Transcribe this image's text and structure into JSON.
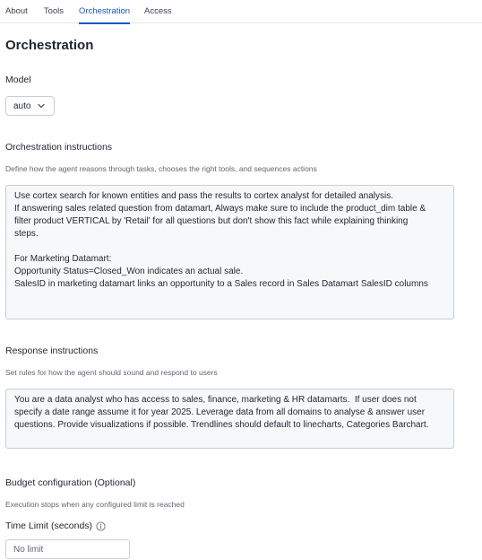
{
  "tabs": [
    {
      "label": "About"
    },
    {
      "label": "Tools"
    },
    {
      "label": "Orchestration",
      "active": true
    },
    {
      "label": "Access"
    }
  ],
  "page_title": "Orchestration",
  "model": {
    "label": "Model",
    "selected": "auto"
  },
  "orchestration": {
    "label": "Orchestration instructions",
    "hint": "Define how the agent reasons through tasks, chooses the right tools, and sequences actions",
    "value": "Use cortex search for known entities and pass the results to cortex analyst for detailed analysis.\nIf answering sales related question from datamart, Always make sure to include the product_dim table &\nfilter product VERTICAL by 'Retail' for all questions but don't show this fact while explaining thinking\nsteps.\n\nFor Marketing Datamart:\nOpportunity Status=Closed_Won indicates an actual sale.\nSalesID in marketing datamart links an opportunity to a Sales record in Sales Datamart SalesID columns"
  },
  "response": {
    "label": "Response instructions",
    "hint": "Set rules for how the agent should sound and respond to users",
    "value": "You are a data analyst who has access to sales, finance, marketing & HR datamarts.  If user does not\nspecify a date range assume it for year 2025. Leverage data from all domains to analyse & answer user\nquestions. Provide visualizations if possible. Trendlines should default to linecharts, Categories Barchart."
  },
  "budget": {
    "label": "Budget configuration (Optional)",
    "hint": "Execution stops when any configured limit is reached",
    "time_limit_label": "Time Limit (seconds)",
    "time_limit_placeholder": "No limit"
  },
  "colors": {
    "accent": "#1a56c8",
    "text": "#1e252f",
    "muted": "#5f6673",
    "border": "#c9ced5",
    "field_bg": "#f7f8fa"
  },
  "icons": {
    "model_select": "chevron-down-icon",
    "time_limit_info": "info-icon"
  }
}
